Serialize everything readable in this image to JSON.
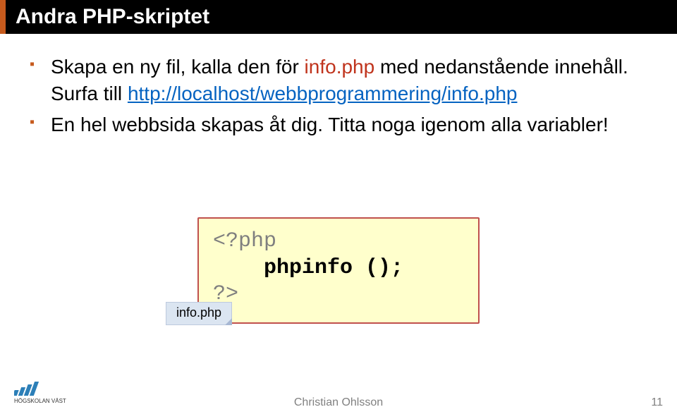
{
  "slide": {
    "title": "Andra PHP-skriptet",
    "bullets": [
      {
        "pre": "Skapa en ny fil, kalla den för ",
        "highlight": "info.php",
        "mid": " med nedanstående innehåll. Surfa till ",
        "link": "http://localhost/webbprogrammering/info.php"
      },
      {
        "text": "En hel webbsida skapas åt dig. Titta noga igenom alla variabler!"
      }
    ]
  },
  "code": {
    "open_tag": "<?php",
    "body_indent": "    ",
    "func": "phpinfo ();",
    "close_tag": "?>"
  },
  "filetab": {
    "label": "info.php"
  },
  "footer": {
    "logo_text": "HÖGSKOLAN VÄST",
    "author": "Christian Ohlsson",
    "page": "11"
  },
  "colors": {
    "accent": "#c65a1d",
    "link": "#0563c1",
    "code_bg": "#ffffcc",
    "code_border": "#c0504d"
  }
}
